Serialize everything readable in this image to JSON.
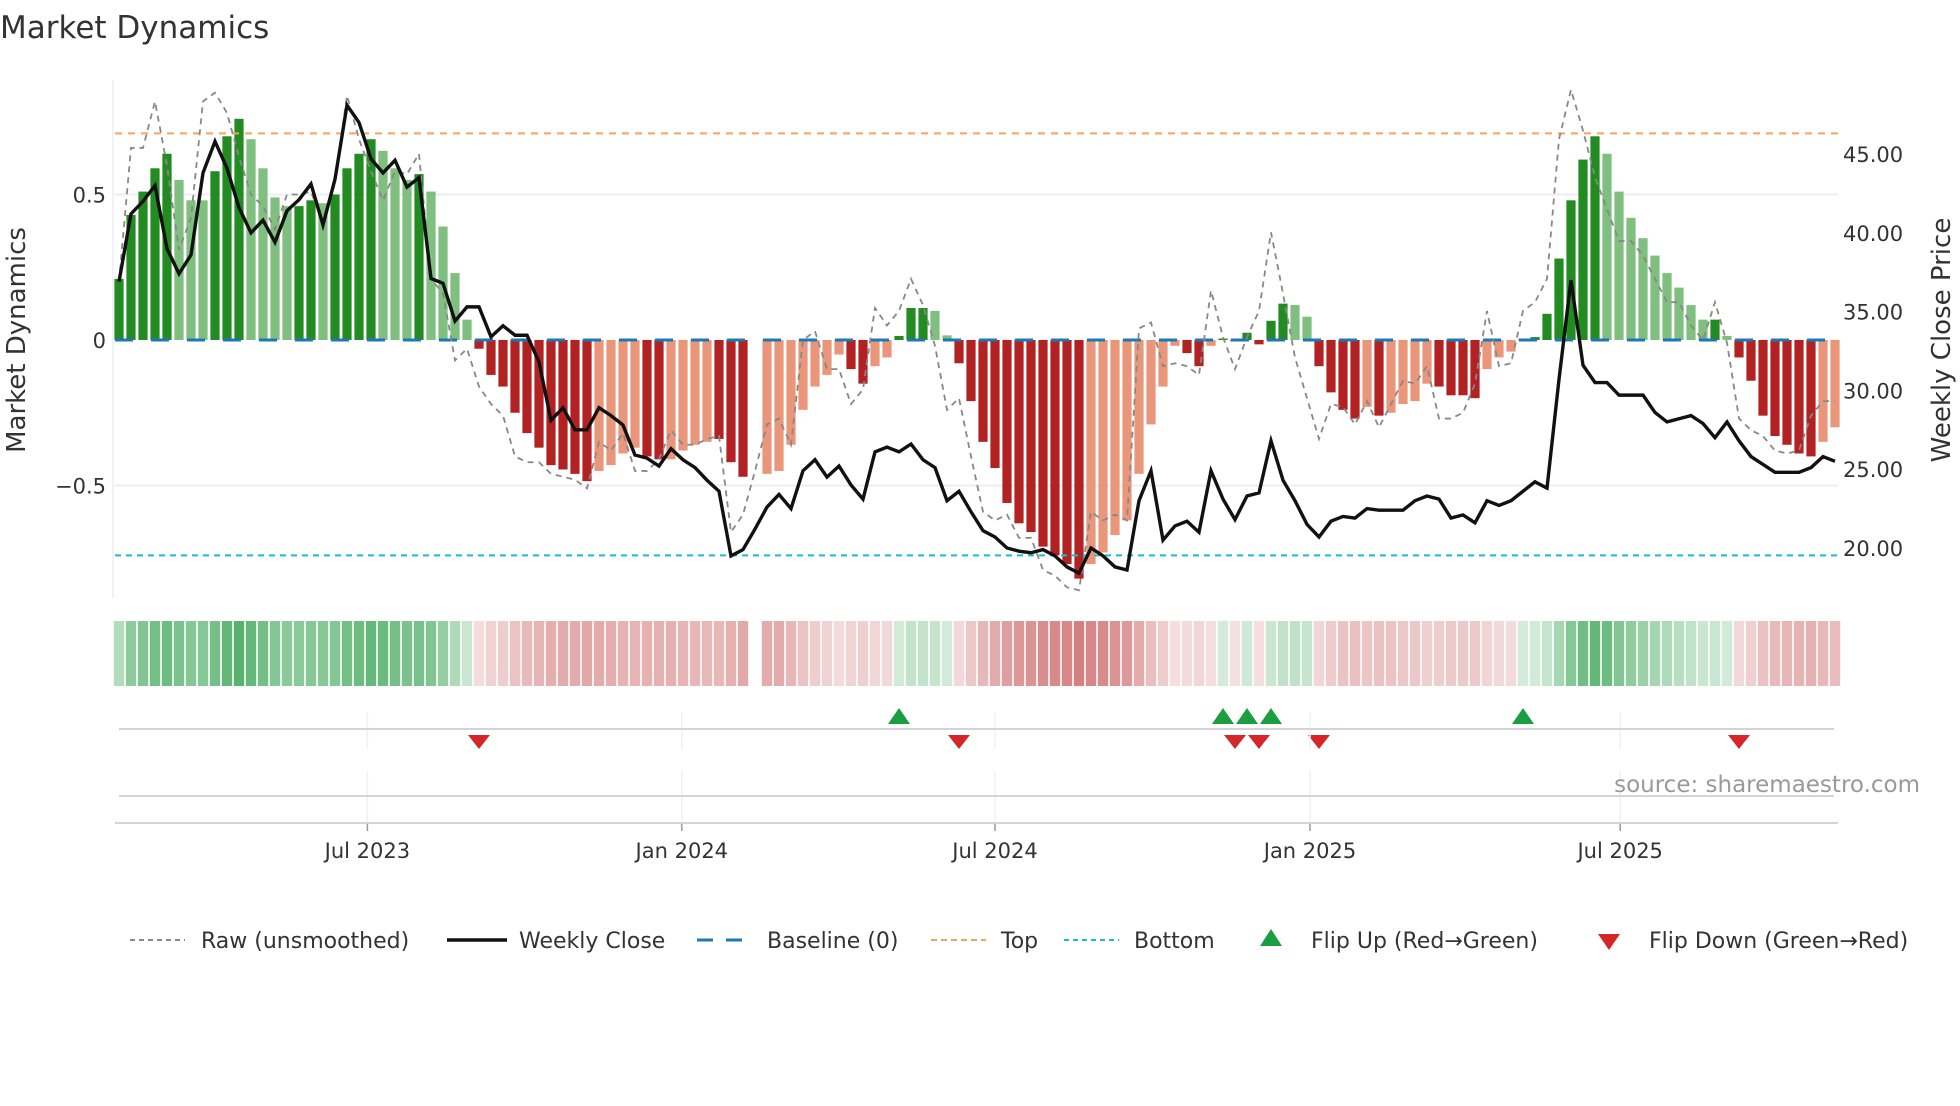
{
  "chart_data": {
    "type": "bar",
    "title": "Market Dynamics",
    "ylabel": "Market Dynamics",
    "ylabel_right": "Weekly Close Price",
    "ylim": [
      -0.92,
      0.94
    ],
    "ylim_right": [
      16.5,
      48.5
    ],
    "yticks": [
      {
        "value": 0.5,
        "label": "0.5"
      },
      {
        "value": 0,
        "label": "0"
      },
      {
        "value": -0.5,
        "label": "−0.5"
      }
    ],
    "yticks_right": [
      {
        "value": 45,
        "label": "45.00"
      },
      {
        "value": 40,
        "label": "40.00"
      },
      {
        "value": 35,
        "label": "35.00"
      },
      {
        "value": 30,
        "label": "30.00"
      },
      {
        "value": 25,
        "label": "25.00"
      },
      {
        "value": 20,
        "label": "20.00"
      }
    ],
    "xticks": [
      {
        "week": 20.7,
        "label": "Jul 2023"
      },
      {
        "week": 46.9,
        "label": "Jan 2024"
      },
      {
        "week": 73.0,
        "label": "Jul 2024"
      },
      {
        "week": 99.25,
        "label": "Jan 2025"
      },
      {
        "week": 125.1,
        "label": "Jul 2025"
      }
    ],
    "top_level": 0.71,
    "bottom_level": -0.74,
    "baseline": 0,
    "momentum": [
      0.21,
      0.43,
      0.51,
      0.59,
      0.64,
      0.55,
      0.48,
      0.48,
      0.58,
      0.7,
      0.76,
      0.69,
      0.59,
      0.49,
      0.46,
      0.46,
      0.48,
      0.47,
      0.5,
      0.59,
      0.64,
      0.69,
      0.65,
      0.59,
      0.55,
      0.57,
      0.51,
      0.39,
      0.23,
      0.07,
      -0.03,
      -0.12,
      -0.16,
      -0.25,
      -0.32,
      -0.37,
      -0.43,
      -0.445,
      -0.46,
      -0.485,
      -0.45,
      -0.43,
      -0.39,
      -0.37,
      -0.4,
      -0.41,
      -0.41,
      -0.38,
      -0.36,
      -0.35,
      -0.34,
      -0.42,
      -0.47,
      null,
      -0.46,
      -0.45,
      -0.36,
      -0.24,
      -0.16,
      -0.12,
      -0.05,
      -0.1,
      -0.15,
      -0.09,
      -0.06,
      0.014,
      0.11,
      0.11,
      0.1,
      0.016,
      -0.08,
      -0.21,
      -0.35,
      -0.44,
      -0.56,
      -0.63,
      -0.66,
      -0.71,
      -0.74,
      -0.77,
      -0.82,
      -0.77,
      -0.73,
      -0.67,
      -0.62,
      -0.46,
      -0.29,
      -0.16,
      -0.02,
      -0.045,
      -0.09,
      -0.02,
      0.005,
      -0.005,
      0.025,
      -0.015,
      0.066,
      0.125,
      0.12,
      0.08,
      -0.09,
      -0.18,
      -0.24,
      -0.27,
      -0.23,
      -0.26,
      -0.25,
      -0.22,
      -0.21,
      -0.15,
      -0.16,
      -0.19,
      -0.19,
      -0.2,
      -0.1,
      -0.06,
      -0.04,
      0.004,
      0.01,
      0.09,
      0.28,
      0.48,
      0.62,
      0.7,
      0.64,
      0.51,
      0.42,
      0.35,
      0.29,
      0.23,
      0.18,
      0.12,
      0.07,
      0.07,
      0.014,
      -0.06,
      -0.14,
      -0.26,
      -0.33,
      -0.36,
      -0.39,
      -0.4,
      -0.35,
      -0.3
    ],
    "shade": "DDDDDLLLDDDLLLLDDLDDDDLLLDLLLLDDDDDDDDDDLLLLDDLLLLDDDLLLLLLLLDDLLDDDLLDDDDDDDDDDDLLLLLLLLDDLDDDDDDLLDDDDLDLLLLDDDDLLLDDDDDDDLLLLLLLLLDLDDDDDDDLL",
    "raw": [
      0.2,
      0.66,
      0.66,
      0.82,
      0.6,
      0.31,
      0.42,
      0.82,
      0.85,
      0.78,
      0.63,
      0.5,
      0.46,
      0.38,
      0.5,
      0.5,
      0.51,
      0.4,
      0.55,
      0.84,
      0.69,
      0.58,
      0.48,
      0.58,
      0.57,
      0.64,
      0.21,
      0.16,
      -0.07,
      -0.03,
      -0.16,
      -0.22,
      -0.26,
      -0.4,
      -0.42,
      -0.42,
      -0.46,
      -0.47,
      -0.48,
      -0.51,
      -0.35,
      -0.38,
      -0.32,
      -0.45,
      -0.45,
      -0.41,
      -0.31,
      -0.36,
      -0.36,
      -0.34,
      -0.33,
      -0.66,
      -0.6,
      -0.45,
      -0.29,
      -0.27,
      -0.36,
      0,
      0.03,
      -0.1,
      -0.1,
      -0.22,
      -0.17,
      0.11,
      0.05,
      0.1,
      0.21,
      0.12,
      -0.02,
      -0.24,
      -0.2,
      -0.4,
      -0.59,
      -0.62,
      -0.6,
      -0.68,
      -0.68,
      -0.79,
      -0.81,
      -0.85,
      -0.86,
      -0.59,
      -0.62,
      -0.6,
      -0.62,
      0.04,
      0.06,
      -0.09,
      -0.08,
      -0.09,
      -0.12,
      0.17,
      0.01,
      -0.1,
      0.01,
      0.1,
      0.37,
      0.16,
      -0.06,
      -0.2,
      -0.34,
      -0.22,
      -0.23,
      -0.29,
      -0.21,
      -0.3,
      -0.22,
      -0.14,
      -0.15,
      -0.09,
      -0.27,
      -0.27,
      -0.25,
      -0.15,
      0.1,
      -0.09,
      -0.08,
      0.1,
      0.13,
      0.21,
      0.69,
      0.86,
      0.72,
      0.56,
      0.45,
      0.34,
      0.34,
      0.29,
      0.21,
      0.13,
      0.13,
      0.05,
      0,
      0.13,
      -0.01,
      -0.27,
      -0.31,
      -0.33,
      -0.38,
      -0.39,
      -0.38,
      -0.26,
      -0.21,
      -0.21
    ],
    "weekly_close": [
      36.9,
      41.2,
      42.0,
      43.0,
      39.0,
      37.4,
      38.6,
      43.8,
      45.8,
      44.1,
      41.6,
      40.0,
      40.8,
      39.4,
      41.4,
      42.1,
      43.1,
      40.5,
      43.4,
      48.1,
      47.0,
      44.7,
      43.8,
      44.6,
      42.9,
      43.5,
      37.1,
      36.8,
      34.4,
      35.3,
      35.3,
      33.4,
      34.1,
      33.5,
      33.5,
      31.8,
      28.1,
      28.9,
      27.5,
      27.5,
      28.9,
      28.4,
      27.8,
      25.9,
      25.7,
      25.2,
      26.3,
      25.6,
      25.1,
      24.3,
      23.6,
      19.5,
      19.9,
      21.2,
      22.6,
      23.4,
      22.5,
      24.9,
      25.6,
      24.5,
      25.2,
      24.0,
      23.1,
      26.1,
      26.4,
      26.1,
      26.6,
      25.6,
      25.1,
      23.0,
      23.6,
      22.3,
      21.1,
      20.7,
      20.0,
      19.8,
      19.7,
      19.9,
      19.5,
      18.8,
      18.4,
      20.0,
      19.5,
      18.8,
      18.6,
      23.0,
      24.9,
      20.5,
      21.4,
      21.7,
      21.0,
      24.9,
      23.1,
      21.8,
      23.3,
      23.5,
      26.8,
      24.3,
      23.0,
      21.5,
      20.7,
      21.7,
      22.0,
      21.9,
      22.5,
      22.4,
      22.4,
      22.4,
      23.0,
      23.3,
      23.1,
      21.9,
      22.1,
      21.6,
      23.0,
      22.7,
      23.0,
      23.6,
      24.2,
      23.8,
      30.7,
      37.0,
      31.6,
      30.5,
      30.5,
      29.7,
      29.7,
      29.7,
      28.6,
      28.0,
      28.2,
      28.4,
      27.9,
      27.0,
      28.0,
      26.8,
      25.8,
      25.3,
      24.8,
      24.8,
      24.8,
      25.1,
      25.8,
      25.5
    ],
    "flip_up_weeks": [
      65,
      92,
      94,
      96,
      117
    ],
    "flip_down_weeks": [
      30,
      70,
      93,
      95,
      100,
      135
    ],
    "legend": {
      "placement": "bottom",
      "items": [
        {
          "key": "raw",
          "label": "Raw (unsmoothed)"
        },
        {
          "key": "close",
          "label": "Weekly Close"
        },
        {
          "key": "baseline",
          "label": "Baseline (0)"
        },
        {
          "key": "top",
          "label": "Top"
        },
        {
          "key": "bottom",
          "label": "Bottom"
        },
        {
          "key": "flip_up",
          "label": "Flip Up (Red→Green)"
        },
        {
          "key": "flip_down",
          "label": "Flip Down (Green→Red)"
        }
      ]
    },
    "source": "source: sharemaestro.com",
    "colors": {
      "pos_strong": "#228b22",
      "pos_weak": "#7fbf7f",
      "neg_strong": "#b22222",
      "neg_weak": "#e9967a",
      "raw": "#888888",
      "close": "#111111",
      "baseline": "#1f77b4",
      "top": "#f4a460",
      "bottom": "#17becf",
      "flip_up": "#1a9e3f",
      "flip_down": "#d62728"
    }
  }
}
